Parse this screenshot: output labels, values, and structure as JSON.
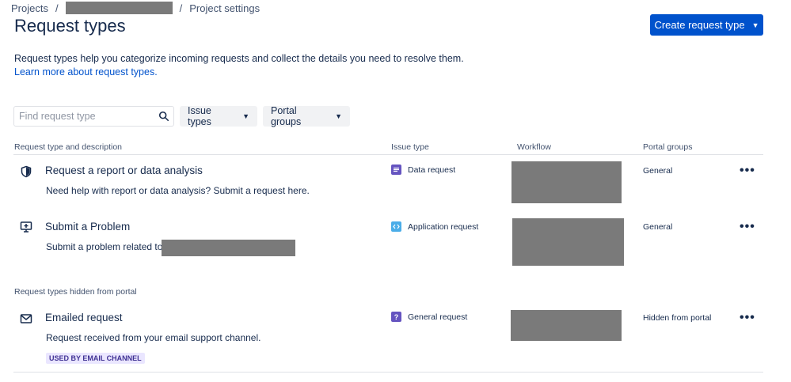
{
  "breadcrumb": {
    "projects": "Projects",
    "separator": "/",
    "current": "Project settings"
  },
  "header": {
    "title": "Request types",
    "create_button": "Create request type"
  },
  "intro": {
    "description": "Request types help you categorize incoming requests and collect the details you need to resolve them.",
    "learn_more": "Learn more about request types."
  },
  "filters": {
    "search_placeholder": "Find request type",
    "issue_types": "Issue types",
    "portal_groups": "Portal groups"
  },
  "table": {
    "columns": [
      "Request type and description",
      "Issue type",
      "Workflow",
      "Portal groups"
    ],
    "rows": [
      {
        "icon": "shield-icon",
        "name": "Request a report or data analysis",
        "description": "Need help with report or data analysis? Submit a request here.",
        "issue_type": "Data request",
        "issue_icon_color": "#6554c0",
        "portal_group": "General"
      },
      {
        "icon": "monitor-plus-icon",
        "name": "Submit a Problem",
        "description": "Submit a problem related to",
        "issue_type": "Application request",
        "issue_icon_color": "#4bade8",
        "portal_group": "General"
      }
    ],
    "hidden_section_label": "Request types hidden from portal",
    "hidden_rows": [
      {
        "icon": "envelope-icon",
        "name": "Emailed request",
        "description": "Request received from your email support channel.",
        "issue_type": "General request",
        "issue_icon_color": "#6554c0",
        "portal_group": "Hidden from portal",
        "lozenge": "USED BY EMAIL CHANNEL"
      }
    ]
  },
  "colors": {
    "primary": "#0052cc",
    "text": "#172b4d",
    "subtle": "#42526e",
    "redacted": "#7a7a7a"
  }
}
